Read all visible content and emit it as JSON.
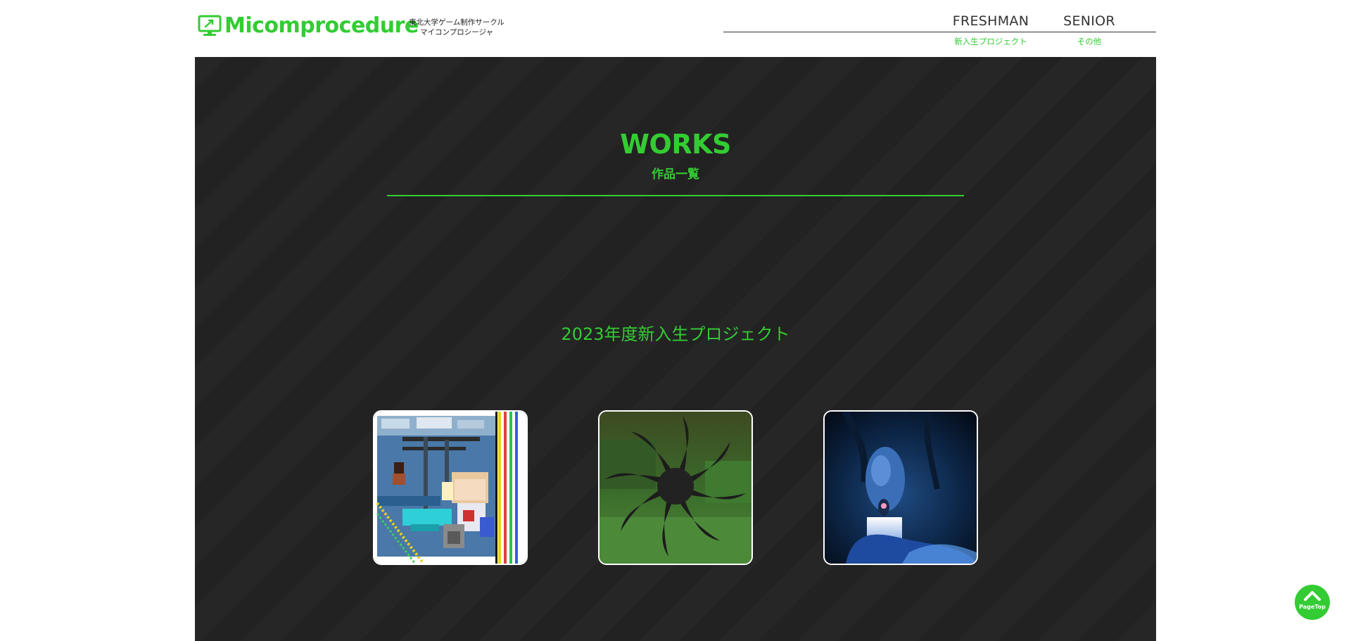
{
  "header": {
    "logo_text": "Micomprocedure",
    "logo_subtitle_line1": "東北大学ゲーム制作サークル",
    "logo_subtitle_line2": "マイコンプロシージャ",
    "nav": [
      {
        "label": "FRESHMAN",
        "sublabel": "新入生プロジェクト"
      },
      {
        "label": "SENIOR",
        "sublabel": "その他"
      }
    ]
  },
  "main": {
    "title": "WORKS",
    "subtitle": "作品一覧",
    "section_heading": "2023年度新入生プロジェクト",
    "works": [
      {
        "thumbnail": "pixel-art-game-thumbnail"
      },
      {
        "thumbnail": "dark-spiral-game-thumbnail"
      },
      {
        "thumbnail": "blue-creature-game-thumbnail"
      }
    ]
  },
  "page_top": {
    "label": "PageTop",
    "icon": "chevron-up-icon"
  },
  "colors": {
    "accent": "#33cc33",
    "background_dark": "#262626",
    "text_dark": "#333333"
  }
}
